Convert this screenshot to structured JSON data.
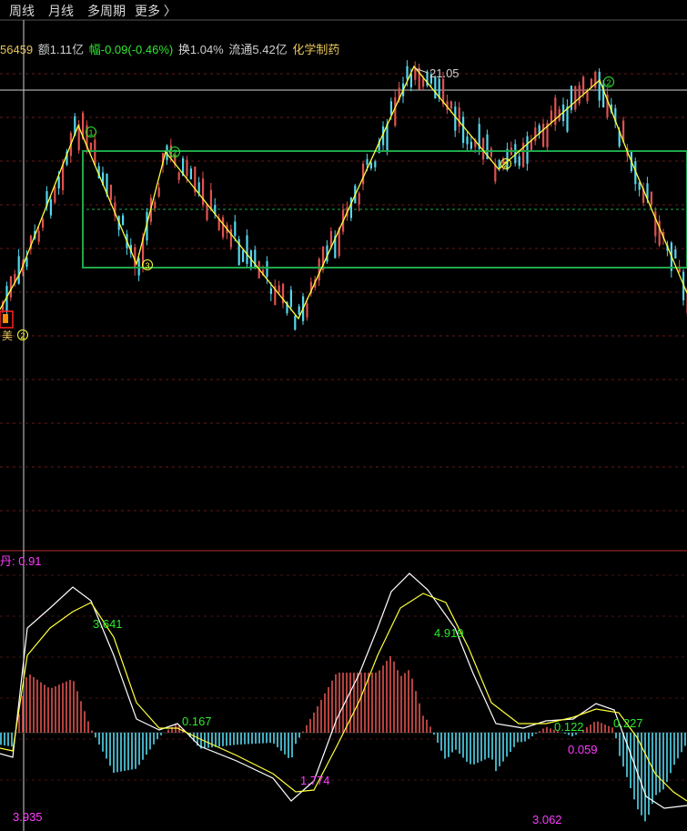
{
  "toolbar": {
    "tabs": [
      {
        "label": "周线"
      },
      {
        "label": "月线"
      },
      {
        "label": "多周期"
      },
      {
        "label": "更多 〉"
      }
    ]
  },
  "infobar": {
    "volume": "56459",
    "amount": "额1.11亿",
    "change_label": "幅",
    "change_value": "-0.09(-0.46%)",
    "turnover": "换1.04%",
    "float_cap": "流通5.42亿",
    "sector": "化学制药"
  },
  "price_chart": {
    "peak_label": "21.05",
    "left_marker": "美"
  },
  "macd_panel": {
    "label": "丹: 0.91"
  },
  "annotations": {
    "p1": "3.641",
    "p2": "0.167",
    "p3": "1.774",
    "p4": "4.919",
    "p5": "0.122",
    "p6": "0.059",
    "p7": "0.227",
    "p8": "3.935",
    "p9": "3.062"
  },
  "colors": {
    "up": "#e0524f",
    "down": "#54d8ee",
    "zigzag": "#ffff3c",
    "macd_line": "#ffffff",
    "signal_line": "#ffff3c",
    "box": "#1fa84a",
    "green_text": "#2ee82e",
    "magenta_text": "#ff3cff"
  }
}
